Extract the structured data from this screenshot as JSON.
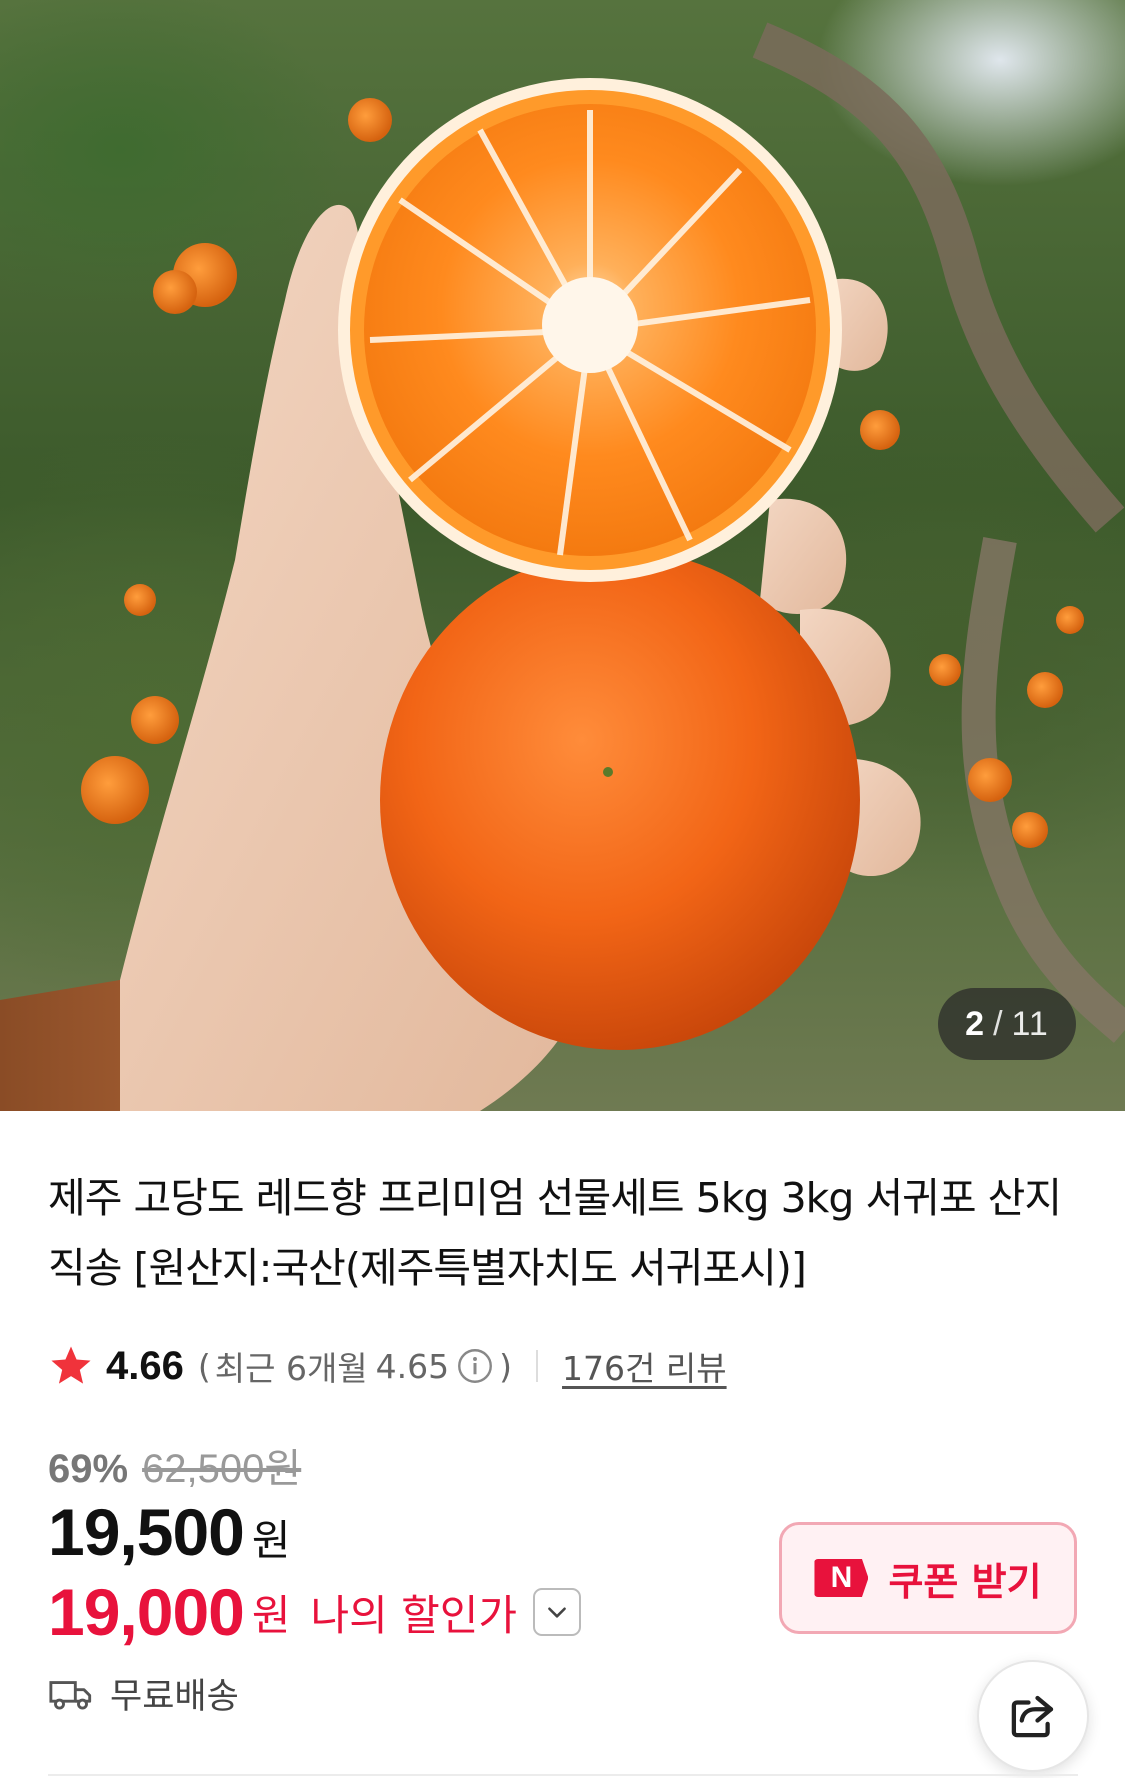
{
  "gallery": {
    "current": "2",
    "separator": "/",
    "total": "11"
  },
  "product": {
    "title": "제주 고당도 레드향 프리미엄 선물세트 5kg 3kg 서귀포 산지직송 [원산지:국산(제주특별자치도 서귀포시)]"
  },
  "rating": {
    "icon": "star-icon",
    "score": "4.66",
    "paren_open": "(",
    "recent_label": "최근 6개월",
    "recent_score": "4.65",
    "paren_close": ")",
    "review_count_label": "176건 리뷰"
  },
  "pricing": {
    "discount_percent": "69%",
    "original_price": "62,500원",
    "sale_price": "19,500",
    "sale_unit": "원",
    "my_price": "19,000",
    "my_price_unit": "원",
    "my_price_label": "나의 할인가"
  },
  "coupon": {
    "badge": "N",
    "label": "쿠폰 받기"
  },
  "shipping": {
    "label": "무료배송"
  },
  "colors": {
    "accent_red": "#e8123c",
    "coupon_bg": "#fff1f3",
    "coupon_border": "#f2a8b4"
  }
}
